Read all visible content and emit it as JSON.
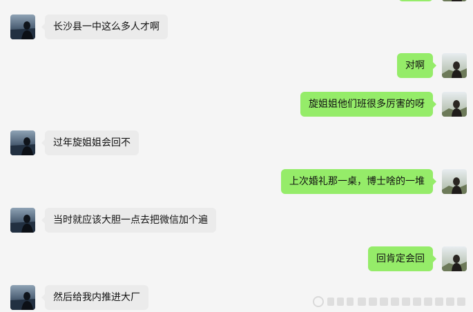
{
  "conversation": {
    "messages": [
      {
        "side": "left",
        "text": "长沙县一中这么多人才啊"
      },
      {
        "side": "right",
        "text": "对啊"
      },
      {
        "side": "right",
        "text": "旋姐姐他们班很多厉害的呀"
      },
      {
        "side": "left",
        "text": "过年旋姐姐会回不"
      },
      {
        "side": "right",
        "text": "上次婚礼那一桌，博士啥的一堆"
      },
      {
        "side": "left",
        "text": "当时就应该大胆一点去把微信加个遍"
      },
      {
        "side": "right",
        "text": "回肯定会回"
      },
      {
        "side": "left",
        "text": "然后给我内推进大厂"
      }
    ]
  },
  "colors": {
    "background": "#f5f5f5",
    "incoming_bubble": "#ebebeb",
    "outgoing_bubble": "#95ec69",
    "text": "#111111"
  },
  "icons": {
    "incoming_avatar": "contact-avatar-icon",
    "outgoing_avatar": "self-avatar-icon",
    "watermark": "watermark-logo"
  }
}
